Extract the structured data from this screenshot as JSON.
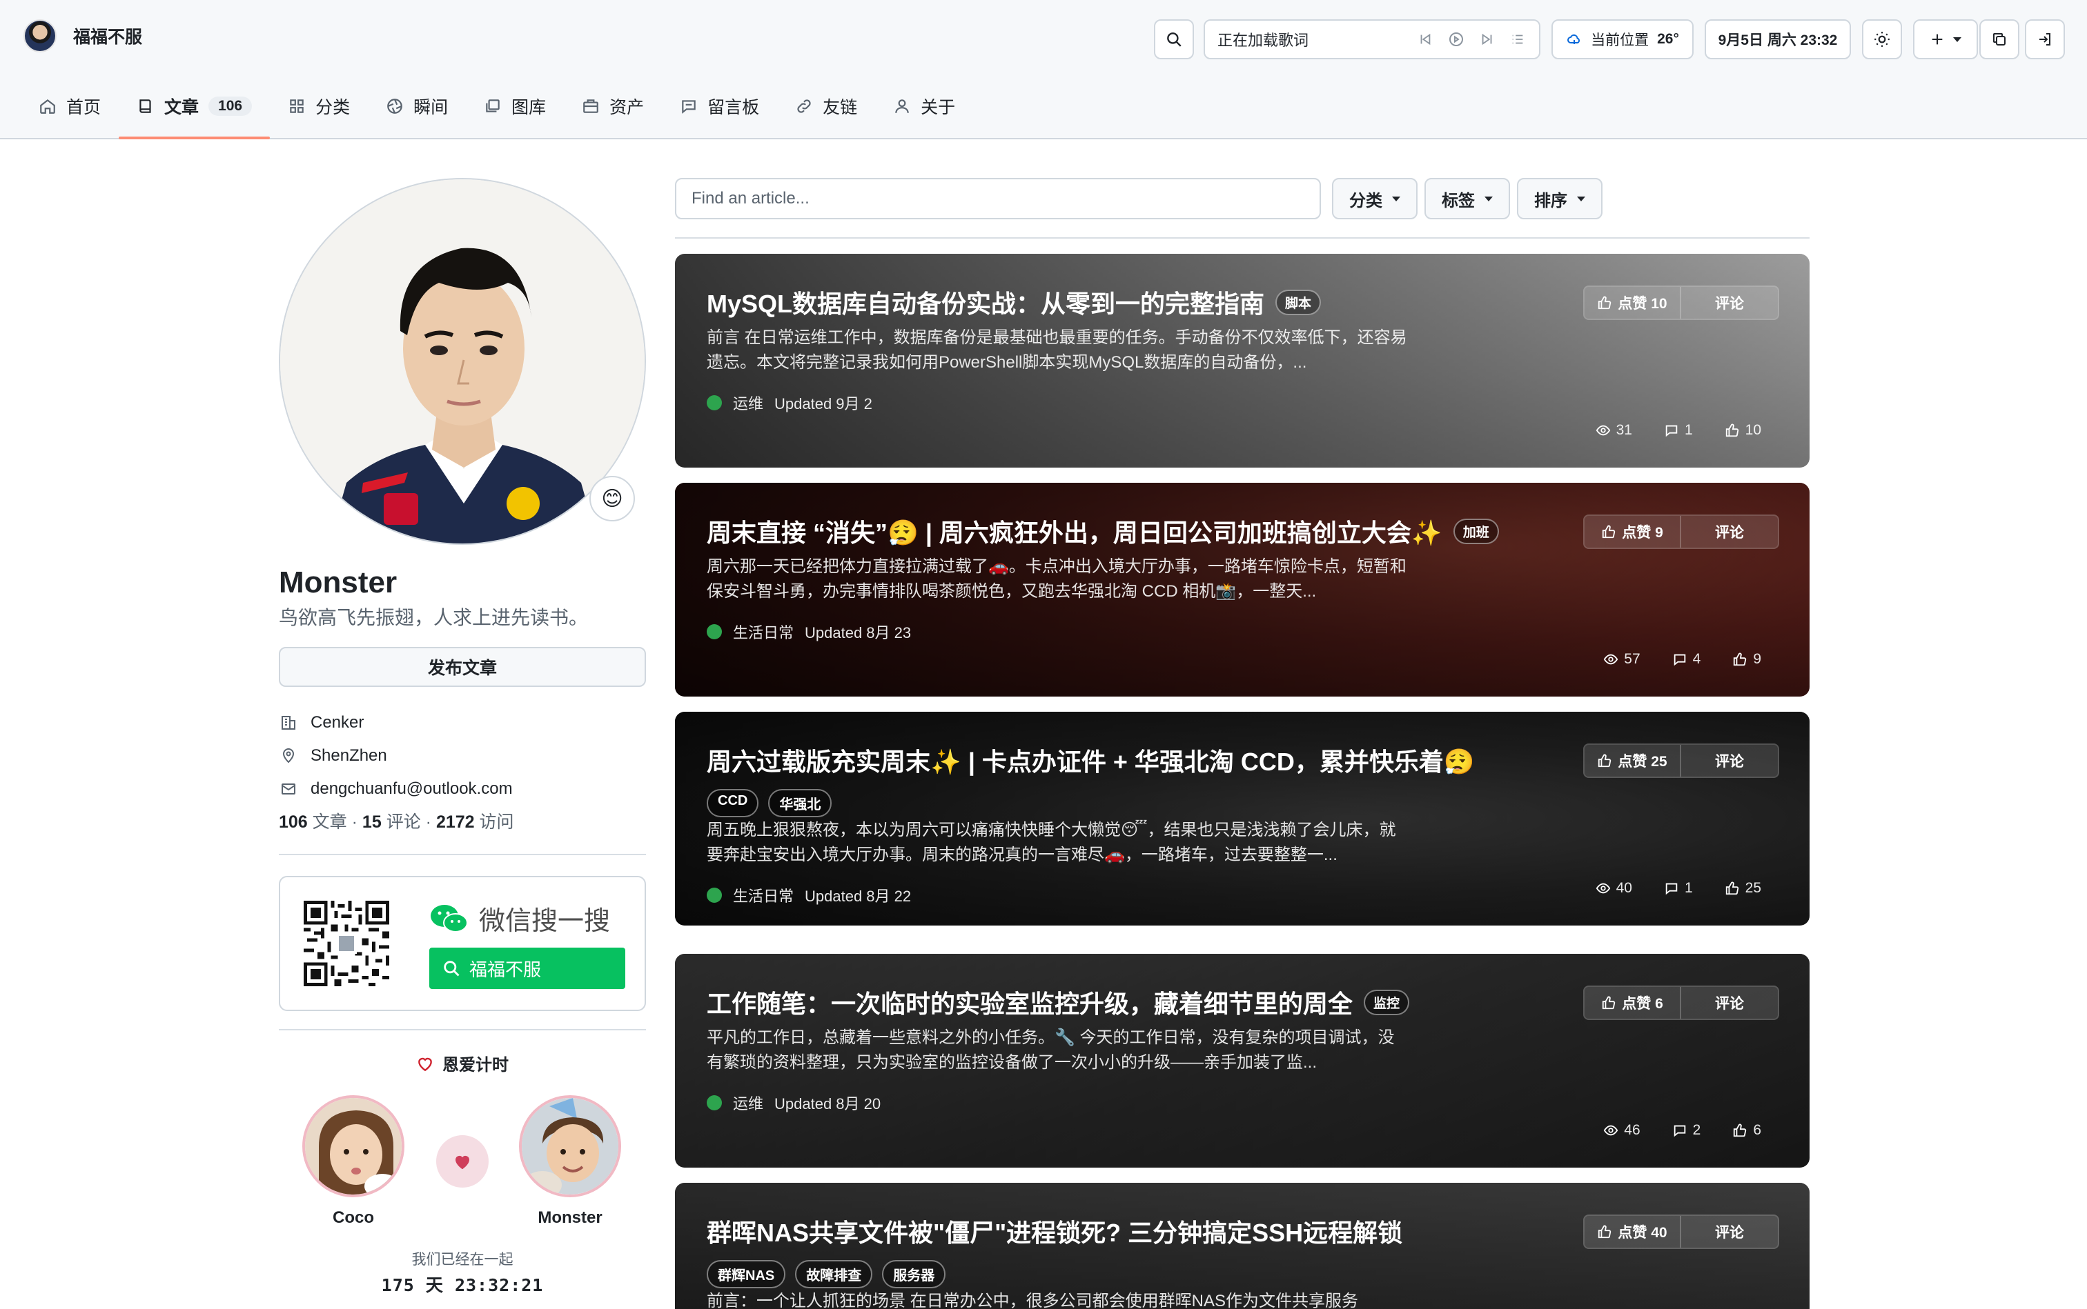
{
  "header": {
    "site_name": "福福不服",
    "lyrics": "正在加载歌词",
    "weather": {
      "location": "当前位置",
      "temp": "26°"
    },
    "datetime": "9月5日 周六 23:32"
  },
  "nav": [
    {
      "label": "首页",
      "icon": "home-icon"
    },
    {
      "label": "文章",
      "icon": "book-icon",
      "count": "106",
      "active": true
    },
    {
      "label": "分类",
      "icon": "grid-icon"
    },
    {
      "label": "瞬间",
      "icon": "aperture-icon"
    },
    {
      "label": "图库",
      "icon": "image-icon"
    },
    {
      "label": "资产",
      "icon": "package-icon"
    },
    {
      "label": "留言板",
      "icon": "comment-icon"
    },
    {
      "label": "友链",
      "icon": "link-icon"
    },
    {
      "label": "关于",
      "icon": "person-icon"
    }
  ],
  "profile": {
    "name": "Monster",
    "bio": "鸟欲高飞先振翅，人求上进先读书。",
    "publish_label": "发布文章",
    "org": "Cenker",
    "location": "ShenZhen",
    "email": "dengchuanfu@outlook.com",
    "stats": {
      "articles": "106",
      "articles_label": "文章",
      "comments": "15",
      "comments_label": "评论",
      "visits": "2172",
      "visits_label": "访问",
      "sep": "·"
    }
  },
  "wechat": {
    "title": "微信搜一搜",
    "search_text": "福福不服"
  },
  "love": {
    "title": "恩爱计时",
    "left_name": "Coco",
    "right_name": "Monster",
    "together_text": "我们已经在一起",
    "days": "175",
    "days_unit": "天",
    "time": "23:32:21"
  },
  "search": {
    "placeholder": "Find an article..."
  },
  "filters": {
    "category": "分类",
    "tags": "标签",
    "sort": "排序"
  },
  "articles": [
    {
      "title": "MySQL数据库自动备份实战：从零到一的完整指南",
      "badge": "脚本",
      "excerpt": "前言 在日常运维工作中，数据库备份是最基础也最重要的任务。手动备份不仅效率低下，还容易遗忘。本文将完整记录我如何用PowerShell脚本实现MySQL数据库的自动备份，...",
      "category": "运维",
      "updated": "Updated 9月 2",
      "like_label": "点赞 10",
      "comment_label": "评论",
      "views": "31",
      "comments": "1",
      "likes": "10"
    },
    {
      "title": "周末直接 “消失”😮‍💨 | 周六疯狂外出，周日回公司加班搞创立大会✨",
      "badge": "加班",
      "excerpt": "周六那一天已经把体力直接拉满过载了🚗。卡点冲出入境大厅办事，一路堵车惊险卡点，短暂和保安斗智斗勇，办完事情排队喝茶颜悦色，又跑去华强北淘 CCD 相机📸，一整天...",
      "category": "生活日常",
      "updated": "Updated 8月 23",
      "like_label": "点赞 9",
      "comment_label": "评论",
      "views": "57",
      "comments": "4",
      "likes": "9"
    },
    {
      "title": "周六过载版充实周末✨ | 卡点办证件 + 华强北淘 CCD，累并快乐着😮‍💨",
      "tags": [
        "CCD",
        "华强北"
      ],
      "excerpt": "周五晚上狠狠熬夜，本以为周六可以痛痛快快睡个大懒觉😴，结果也只是浅浅赖了会儿床，就要奔赴宝安出入境大厅办事。周末的路况真的一言难尽🚗，一路堵车，过去要整整一...",
      "category": "生活日常",
      "updated": "Updated 8月 22",
      "like_label": "点赞 25",
      "comment_label": "评论",
      "views": "40",
      "comments": "1",
      "likes": "25"
    },
    {
      "title": "工作随笔：一次临时的实验室监控升级，藏着细节里的周全",
      "badge": "监控",
      "excerpt": "平凡的工作日，总藏着一些意料之外的小任务。🔧 今天的工作日常，没有复杂的项目调试，没有繁琐的资料整理，只为实验室的监控设备做了一次小小的升级——亲手加装了监...",
      "category": "运维",
      "updated": "Updated 8月 20",
      "like_label": "点赞 6",
      "comment_label": "评论",
      "views": "46",
      "comments": "2",
      "likes": "6"
    },
    {
      "title": "群晖NAS共享文件被\"僵尸\"进程锁死? 三分钟搞定SSH远程解锁",
      "tags": [
        "群辉NAS",
        "故障排查",
        "服务器"
      ],
      "excerpt": "前言：一个让人抓狂的场景 在日常办公中，很多公司都会使用群晖NAS作为文件共享服务",
      "like_label": "点赞 40",
      "comment_label": "评论"
    }
  ]
}
